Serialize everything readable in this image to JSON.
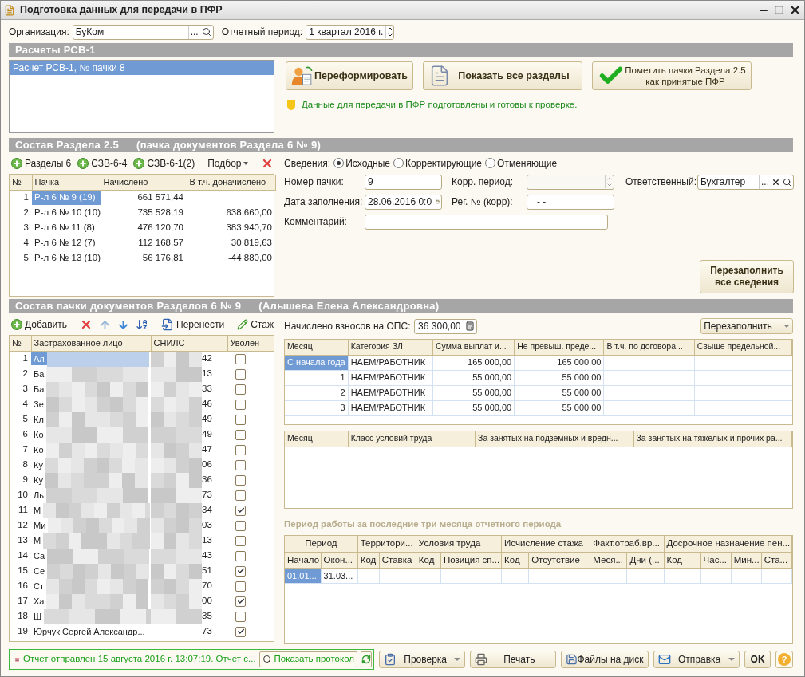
{
  "window": {
    "title": "Подготовка данных для передачи в ПФР"
  },
  "organization": {
    "label": "Организация:",
    "value": "БуКом",
    "select_button": "..."
  },
  "period": {
    "label": "Отчетный период:",
    "value": "1 квартал 2016 г."
  },
  "rsv": {
    "title": "Расчеты РСВ-1",
    "items": [
      {
        "label": "Расчет РСВ-1, № пачки 8",
        "selected": true
      }
    ],
    "buttons": [
      {
        "kind": "reform",
        "lines": [
          "Переформировать"
        ]
      },
      {
        "kind": "sections",
        "lines": [
          "Показать все разделы"
        ]
      },
      {
        "kind": "accept",
        "lines": [
          "Пометить пачки Раздела 2.5",
          "как принятые ПФР"
        ]
      }
    ],
    "info": "Данные для передачи в ПФР подготовлены и готовы к проверке."
  },
  "section25": {
    "title": "Состав Раздела 2.5",
    "subtitle": "(пачка документов Раздела 6 № 9)",
    "toolbar": [
      {
        "kind": "add",
        "label": "Разделы 6"
      },
      {
        "kind": "add",
        "label": "СЗВ-6-4"
      },
      {
        "kind": "add",
        "label": "СЗВ-6-1(2)"
      },
      {
        "kind": "dropdown",
        "label": "Подбор"
      },
      {
        "kind": "delete"
      }
    ],
    "columns": [
      "№",
      "Пачка",
      "Начислено",
      "В т.ч. доначислено"
    ],
    "rows": [
      {
        "n": "1",
        "pack": "Р-л 6 № 9 (19)",
        "accrued": "661 571,44",
        "selected": true
      },
      {
        "n": "2",
        "pack": "Р-л 6 № 10 (10)",
        "accrued": "735 528,19",
        "additional": "638 660,00",
        "selected": false
      },
      {
        "n": "3",
        "pack": "Р-л 6 № 11 (8)",
        "accrued": "476 120,70",
        "additional": "383 940,70",
        "selected": false
      },
      {
        "n": "4",
        "pack": "Р-л 6 № 12 (7)",
        "accrued": "112 168,57",
        "additional": "30 819,63",
        "selected": false
      },
      {
        "n": "5",
        "pack": "Р-л 6 № 13 (10)",
        "accrued": "56 176,81",
        "additional": "-44 880,00",
        "selected": false
      }
    ],
    "svedeniya": {
      "label": "Сведения:",
      "options": [
        {
          "label": "Исходные",
          "selected": true
        },
        {
          "label": "Корректирующие",
          "selected": false
        },
        {
          "label": "Отменяющие",
          "selected": false
        }
      ]
    },
    "fields": {
      "number": {
        "label": "Номер пачки:",
        "value": "9"
      },
      "date": {
        "label": "Дата заполнения:",
        "value": "28.06.2016  0:0"
      },
      "corr_period": {
        "label": "Корр. период:"
      },
      "reg": {
        "label": "Рег. № (корр):",
        "value": "-   -"
      },
      "comment": {
        "label": "Комментарий:"
      },
      "responsible": {
        "label": "Ответственный:",
        "value": "Бухгалтер",
        "select_button": "..."
      }
    },
    "refill_button": {
      "lines": [
        "Перезаполнить",
        "все сведения"
      ]
    }
  },
  "employees": {
    "title": "Состав пачки документов Разделов 6 № 9",
    "subtitle": "(Алышева Елена Александровна)",
    "toolbar": [
      {
        "kind": "add",
        "label": "Добавить"
      },
      {
        "kind": "delete"
      },
      {
        "kind": "up"
      },
      {
        "kind": "down"
      },
      {
        "kind": "sort"
      },
      {
        "kind": "transfer",
        "label": "Перенести"
      },
      {
        "kind": "edit",
        "label": "Стаж"
      }
    ],
    "columns": [
      "№",
      "Застрахованное лицо",
      "СНИЛС",
      "Уволен"
    ],
    "rows": [
      {
        "n": "1",
        "name": "Ал",
        "snils": "42",
        "fired": false,
        "selected": true,
        "redacted": true
      },
      {
        "n": "2",
        "name": "Ба",
        "snils": "13",
        "fired": false,
        "selected": false,
        "redacted": true
      },
      {
        "n": "3",
        "name": "Ба",
        "snils": "33",
        "fired": false,
        "selected": false,
        "redacted": true
      },
      {
        "n": "4",
        "name": "Зе",
        "snils": "46",
        "fired": false,
        "selected": false,
        "redacted": true
      },
      {
        "n": "5",
        "name": "Кл",
        "snils": "49",
        "fired": false,
        "selected": false,
        "redacted": true
      },
      {
        "n": "6",
        "name": "Ко",
        "snils": "49",
        "fired": false,
        "selected": false,
        "redacted": true
      },
      {
        "n": "7",
        "name": "Ко",
        "snils": "47",
        "fired": false,
        "selected": false,
        "redacted": true
      },
      {
        "n": "8",
        "name": "Ку",
        "snils": "06",
        "fired": false,
        "selected": false,
        "redacted": true
      },
      {
        "n": "9",
        "name": "Ку",
        "snils": "36",
        "fired": false,
        "selected": false,
        "redacted": true
      },
      {
        "n": "10",
        "name": "Ль",
        "snils": "73",
        "fired": false,
        "selected": false,
        "redacted": true
      },
      {
        "n": "11",
        "name": "М",
        "snils": "34",
        "fired": true,
        "selected": false,
        "redacted": true
      },
      {
        "n": "12",
        "name": "Ми",
        "snils": "03",
        "fired": false,
        "selected": false,
        "redacted": true
      },
      {
        "n": "13",
        "name": "М",
        "snils": "13",
        "fired": false,
        "selected": false,
        "redacted": true
      },
      {
        "n": "14",
        "name": "Са",
        "snils": "43",
        "fired": false,
        "selected": false,
        "redacted": true
      },
      {
        "n": "15",
        "name": "Се",
        "snils": "51",
        "fired": true,
        "selected": false,
        "redacted": true
      },
      {
        "n": "16",
        "name": "Ст",
        "snils": "70",
        "fired": false,
        "selected": false,
        "redacted": true
      },
      {
        "n": "17",
        "name": "Ха",
        "snils": "00",
        "fired": true,
        "selected": false,
        "redacted": true
      },
      {
        "n": "18",
        "name": "Ш",
        "snils": "35",
        "fired": false,
        "selected": false,
        "redacted": true
      },
      {
        "n": "19",
        "name": "Юрчук Сергей Александр...",
        "snils": "73",
        "fired": true,
        "selected": false,
        "redacted": false
      }
    ],
    "ops": {
      "label": "Начислено взносов на ОПС:",
      "value": "36 300,00"
    },
    "refill_button": {
      "label": "Перезаполнить"
    },
    "payments": {
      "columns": [
        "Месяц",
        "Категория ЗЛ",
        "Сумма выплат и...",
        "Не превыш. преде...",
        "В т.ч. по договора...",
        "Свыше предельной..."
      ],
      "rows": [
        {
          "month": "С начала года",
          "category": "НАЕМ/РАБОТНИК",
          "sum": "165 000,00",
          "limit": "165 000,00",
          "selected": true
        },
        {
          "month": "1",
          "category": "НАЕМ/РАБОТНИК",
          "sum": "55 000,00",
          "limit": "55 000,00",
          "selected": false
        },
        {
          "month": "2",
          "category": "НАЕМ/РАБОТНИК",
          "sum": "55 000,00",
          "limit": "55 000,00",
          "selected": false
        },
        {
          "month": "3",
          "category": "НАЕМ/РАБОТНИК",
          "sum": "55 000,00",
          "limit": "55 000,00",
          "selected": false
        }
      ]
    },
    "conditions": {
      "columns": [
        "Месяц",
        "Класс условий труда",
        "За занятых на подземных и вредн...",
        "За занятых на тяжелых и прочих ра..."
      ]
    },
    "work_period": {
      "title": "Период работы за последние три месяца отчетного периода",
      "groups": [
        {
          "label": "Период",
          "columns": [
            "Начало",
            "Окон..."
          ]
        },
        {
          "label": "Территори...",
          "columns": [
            "Код",
            "Ставка"
          ]
        },
        {
          "label": "Условия труда",
          "columns": [
            "Код",
            "Позиция сп..."
          ]
        },
        {
          "label": "Исчисление стажа",
          "columns": [
            "Код",
            "Отсутствие"
          ]
        },
        {
          "label": "Факт.отраб.вр...",
          "columns": [
            "Меся...",
            "Дни (..."
          ]
        },
        {
          "label": "Досрочное назначение пен...",
          "columns": [
            "Код",
            "Час...",
            "Мин...",
            "Ста..."
          ]
        }
      ],
      "rows": [
        {
          "start": "01.01...",
          "end": "31.03...",
          "selected": true
        }
      ]
    }
  },
  "footer": {
    "status": "Отчет отправлен 15 августа 2016 г. 13:07:19. Отчет с...",
    "protocol_button": "Показать протокол",
    "buttons": [
      {
        "kind": "check",
        "label": "Проверка",
        "dropdown": true
      },
      {
        "kind": "print",
        "label": "Печать",
        "dropdown": false
      },
      {
        "kind": "files",
        "label": "Файлы на диск",
        "dropdown": false
      },
      {
        "kind": "send",
        "label": "Отправка",
        "dropdown": true
      },
      {
        "kind": "ok",
        "label": "OK",
        "dropdown": false
      },
      {
        "kind": "help",
        "label": "?",
        "dropdown": false
      }
    ]
  }
}
